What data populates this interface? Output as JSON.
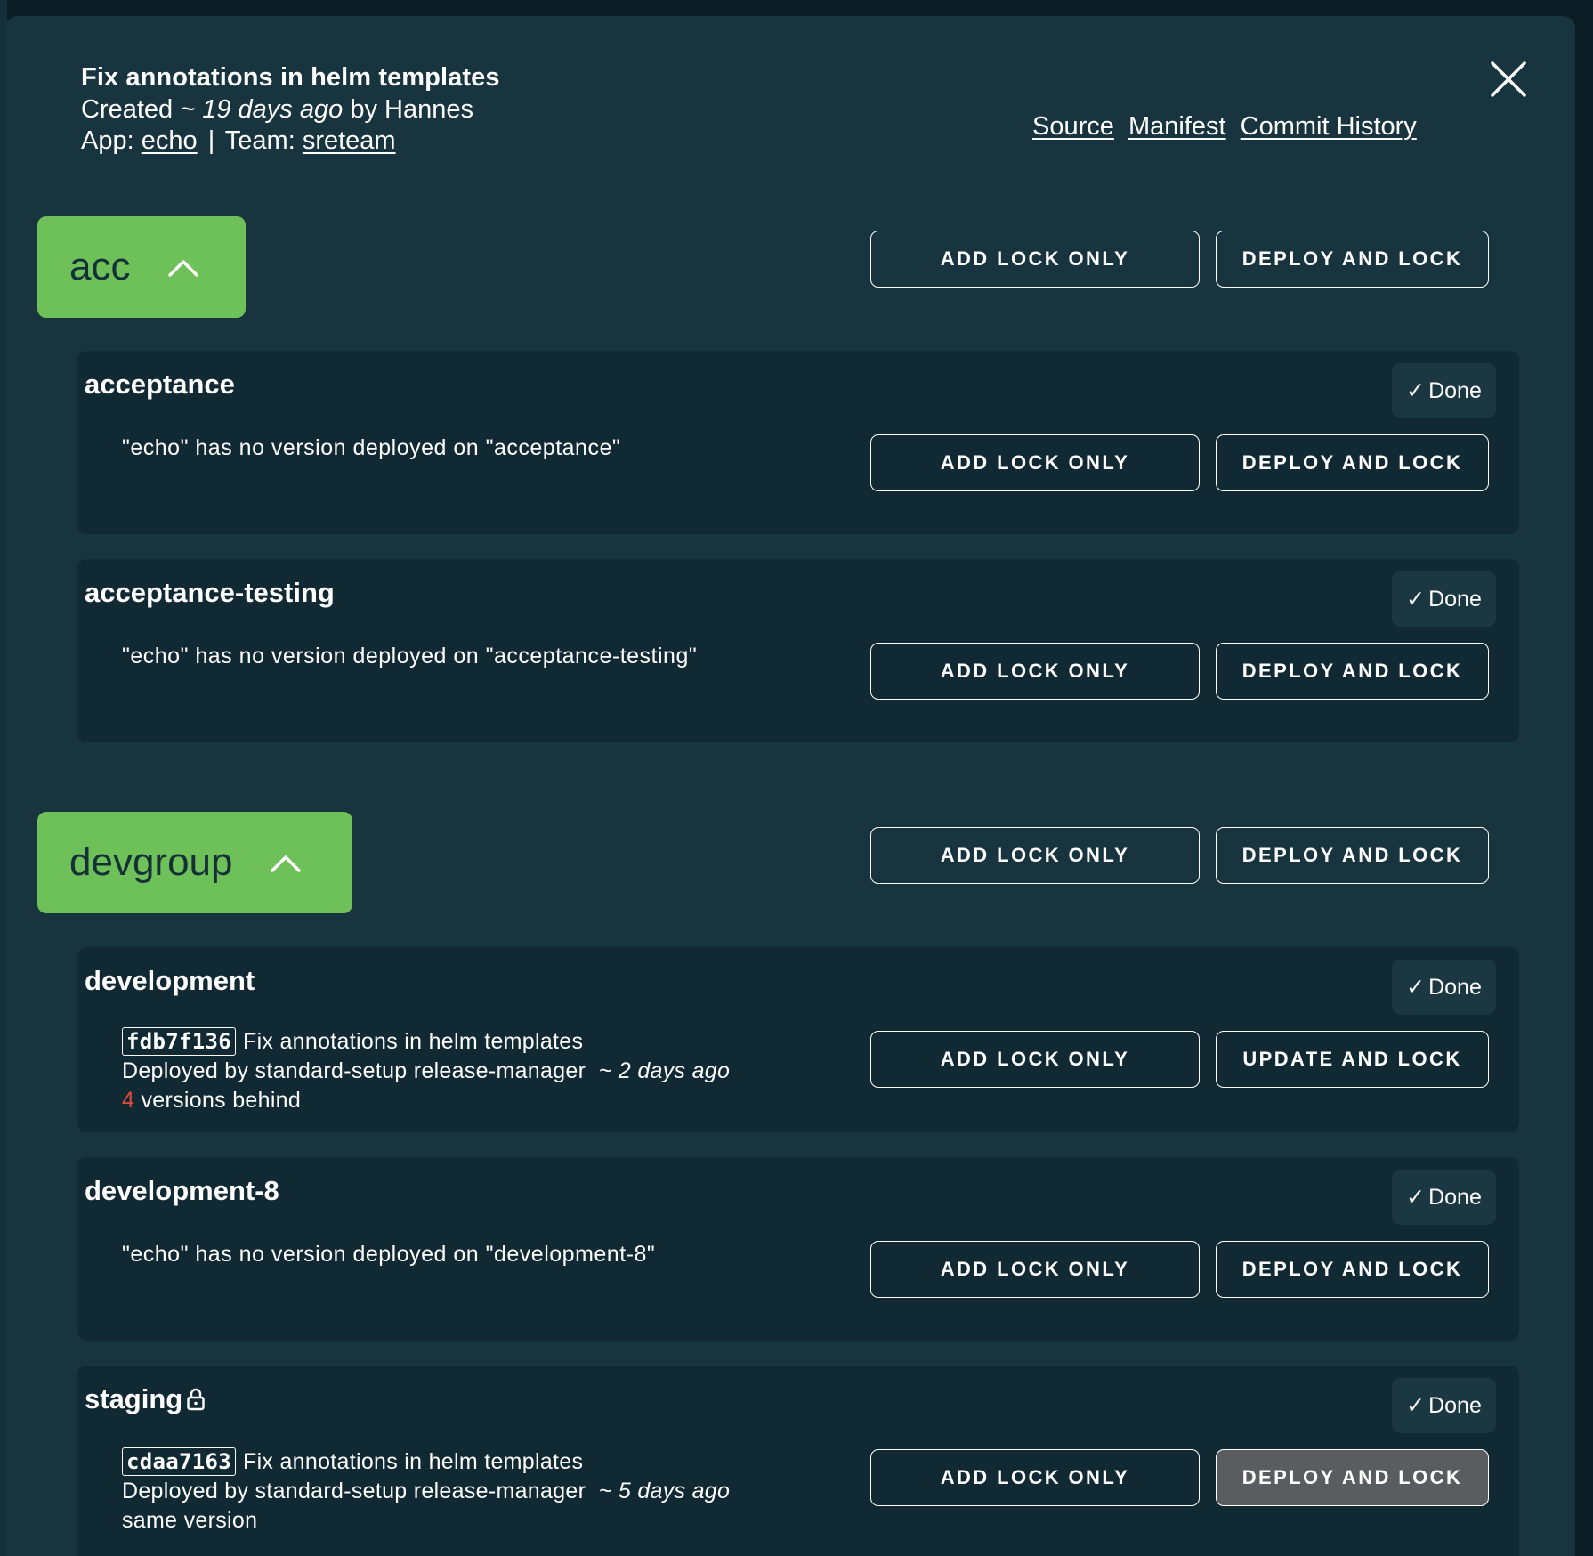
{
  "dialog": {
    "title": "Fix annotations in helm templates",
    "created_prefix": "Created",
    "created_age": "~ 19 days ago",
    "created_by": "by Hannes",
    "app_label": "App:",
    "app_value": "echo",
    "team_label": "Team:",
    "team_value": "sreteam",
    "separator": "|",
    "links": {
      "source": "Source",
      "manifest": "Manifest",
      "history": "Commit History"
    },
    "close_icon": "close-icon"
  },
  "groups": [
    {
      "name": "acc",
      "lock_label": "ADD LOCK ONLY",
      "deploy_label": "DEPLOY AND LOCK",
      "envs": [
        {
          "name": "acceptance",
          "done": "Done",
          "message": "\"echo\" has no version deployed on \"acceptance\"",
          "lock_label": "ADD LOCK ONLY",
          "deploy_label": "DEPLOY AND LOCK"
        },
        {
          "name": "acceptance-testing",
          "done": "Done",
          "message": "\"echo\" has no version deployed on \"acceptance-testing\"",
          "lock_label": "ADD LOCK ONLY",
          "deploy_label": "DEPLOY AND LOCK"
        }
      ]
    },
    {
      "name": "devgroup",
      "lock_label": "ADD LOCK ONLY",
      "deploy_label": "DEPLOY AND LOCK",
      "envs": [
        {
          "name": "development",
          "done": "Done",
          "hash": "fdb7f136",
          "commit_msg": "Fix annotations in helm templates",
          "deployed_by": "Deployed by standard-setup release-manager",
          "age": "~ 2 days ago",
          "behind_count": "4",
          "behind_text": "versions behind",
          "lock_label": "ADD LOCK ONLY",
          "deploy_label": "UPDATE AND LOCK"
        },
        {
          "name": "development-8",
          "done": "Done",
          "message": "\"echo\" has no version deployed on \"development-8\"",
          "lock_label": "ADD LOCK ONLY",
          "deploy_label": "DEPLOY AND LOCK"
        },
        {
          "name": "staging",
          "locked": true,
          "done": "Done",
          "hash": "cdaa7163",
          "commit_msg": "Fix annotations in helm templates",
          "deployed_by": "Deployed by standard-setup release-manager",
          "age": "~ 5 days ago",
          "status": "same version",
          "lock_label": "ADD LOCK ONLY",
          "deploy_label": "DEPLOY AND LOCK"
        }
      ]
    }
  ],
  "colors": {
    "accent": "#6ec159",
    "panel": "#18343f",
    "card": "#112933",
    "behind": "#e14b3b"
  }
}
